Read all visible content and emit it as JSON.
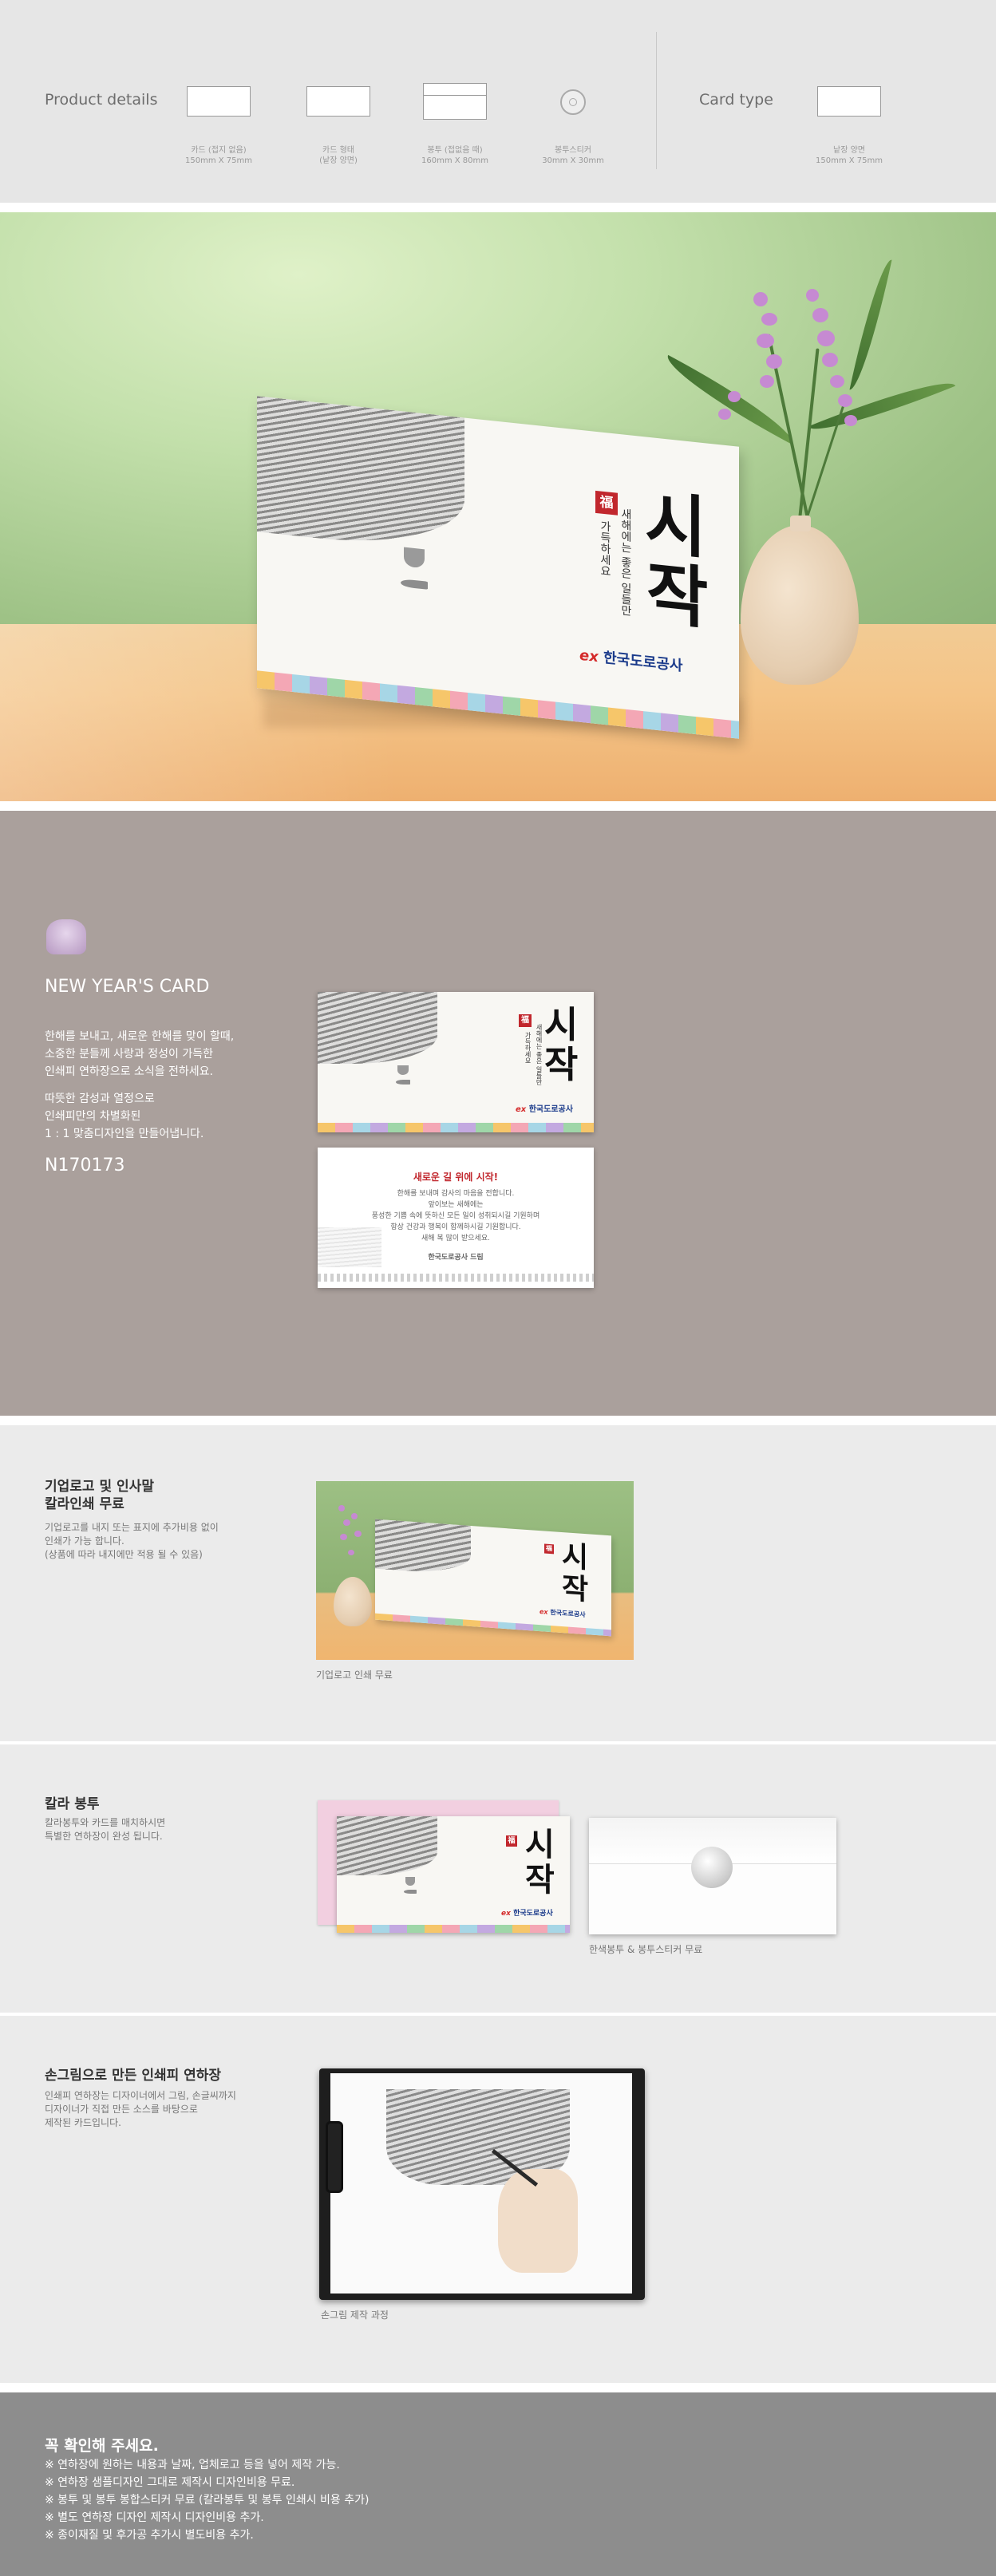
{
  "product_details": {
    "heading": "Product details",
    "items": [
      {
        "label_line1": "카드 (접지 없음)",
        "label_line2": "150mm X 75mm"
      },
      {
        "label_line1": "카드 형태",
        "label_line2": "(낱장 양면)"
      },
      {
        "label_line1": "봉투 (접없음 때)",
        "label_line2": "160mm X 80mm"
      },
      {
        "label_line1": "봉투스티커",
        "label_line2": "30mm X 30mm"
      }
    ],
    "card_type_heading": "Card type",
    "card_type": {
      "label_line1": "낱장 양면",
      "label_line2": "150mm X 75mm"
    }
  },
  "card": {
    "big_text": "시작",
    "big_line1": "시",
    "big_line2": "작",
    "seal_char": "福",
    "vertical_line1": "새해에는 좋은 일들만",
    "vertical_line2": "가득하세요",
    "logo_mark": "ex",
    "logo_name": "한국도로공사"
  },
  "new_year": {
    "title": "NEW YEAR'S CARD",
    "para1_line1": "한해를 보내고, 새로운 한해를 맞이 할때,",
    "para1_line2": "소중한 분들께 사랑과 정성이 가득한",
    "para1_line3": "인쇄피 연하장으로 소식을 전하세요.",
    "para2_line1": "따뜻한 감성과 열정으로",
    "para2_line2": "인쇄피만의 차별화된",
    "para2_line3": "1 : 1 맞춤디자인을 만들어냅니다.",
    "code": "N170173"
  },
  "inner_card": {
    "title": "새로운 길 위에 시작!",
    "line1": "한해를 보내며 감사의 마음을 전합니다.",
    "line2": "앞이보는 새해에는",
    "line3": "풍성한 기쁨 속에 뜻하신 모든 일이 성취되시길 기원하며",
    "line4": "항상 건강과 행복이 함께하시길 기원합니다.",
    "line5": "새해 복 많이 받으세요.",
    "signature": "한국도로공사 드림"
  },
  "feature_logo": {
    "title_line1": "기업로고 및 인사말",
    "title_line2": "칼라인쇄 무료",
    "desc_line1": "기업로고를 내지 또는 표지에 추가비용 없이",
    "desc_line2": "인쇄가 가능 합니다.",
    "desc_line3": "(상품에 따라 내지에만 적용 될 수 있음)",
    "caption": "기업로고 인쇄 무료"
  },
  "feature_envelope": {
    "title": "칼라 봉투",
    "desc_line1": "칼라봉투와 카드를 매치하시면",
    "desc_line2": "특별한 연하장이 완성 됩니다.",
    "caption": "한색봉투 & 봉투스티커 무료"
  },
  "feature_hand": {
    "title": "손그림으로 만든 인쇄피 연하장",
    "desc_line1": "인쇄피 연하장는 디자이너에서 그림, 손글씨까지",
    "desc_line2": "디자이너가 직접 만든 소스를 바탕으로",
    "desc_line3": "제작된 카드입니다.",
    "caption": "손그림 제작 과정"
  },
  "notice": {
    "title": "꼭 확인해 주세요.",
    "items": [
      "※ 연하장에 원하는 내용과 날짜, 업체로고 등을 넣어 제작 가능.",
      "※ 연하장 샘플디자인 그대로 제작시 디자인비용 무료.",
      "※ 봉투 및 봉투 봉합스티커 무료 (칼라봉투 및 봉투 인쇄시 비용 추가)",
      "※ 별도 연하장 디자인 제작시 디자인비용 추가.",
      "※ 종이재질 및 후가공 추가시 별도비용 추가."
    ]
  },
  "colors": {
    "seal_red": "#c1272d",
    "logo_blue": "#1b3b8b",
    "section_taupe": "#aaa09c",
    "notice_gray": "#8d8d8d"
  }
}
